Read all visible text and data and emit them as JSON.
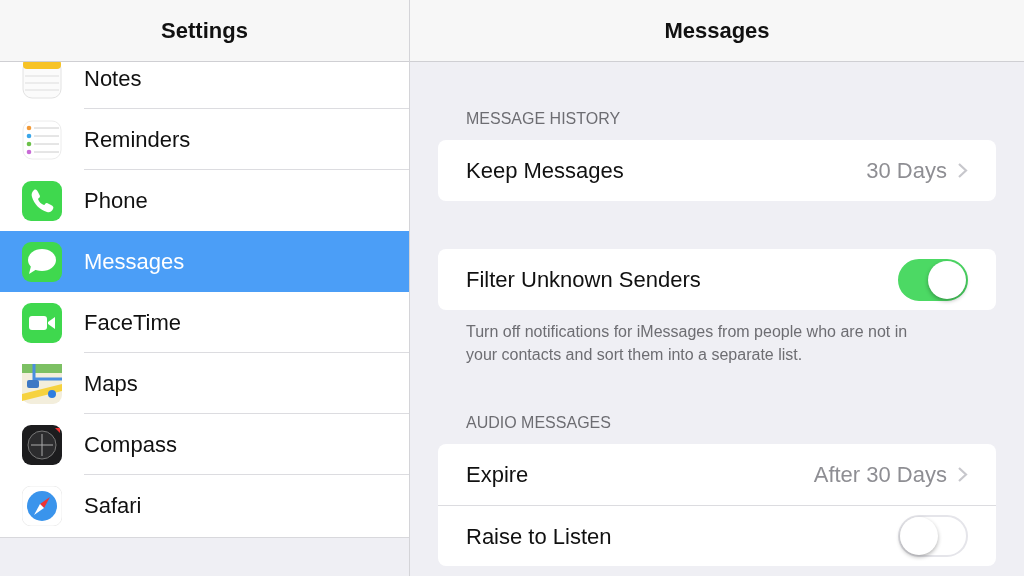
{
  "sidebar": {
    "title": "Settings",
    "items": [
      {
        "label": "Notes",
        "kind": "notes",
        "selected": false
      },
      {
        "label": "Reminders",
        "kind": "checklist",
        "selected": false
      },
      {
        "label": "Phone",
        "kind": "phone",
        "selected": false
      },
      {
        "label": "Messages",
        "kind": "chat",
        "selected": true
      },
      {
        "label": "FaceTime",
        "kind": "video",
        "selected": false
      },
      {
        "label": "Maps",
        "kind": "map",
        "selected": false
      },
      {
        "label": "Compass",
        "kind": "compass",
        "selected": false
      },
      {
        "label": "Safari",
        "kind": "browser",
        "selected": false
      }
    ]
  },
  "detail": {
    "title": "Messages",
    "sections": [
      {
        "header": "MESSAGE HISTORY",
        "rows": [
          {
            "kind": "value",
            "label": "Keep Messages",
            "value": "30 Days"
          }
        ]
      },
      {
        "rows": [
          {
            "kind": "toggle",
            "label": "Filter Unknown Senders",
            "on": true
          }
        ],
        "footer": "Turn off notifications for iMessages from people who are not in your contacts and sort them into a separate list."
      },
      {
        "header": "AUDIO MESSAGES",
        "rows": [
          {
            "kind": "value",
            "label": "Expire",
            "value": "After 30 Days"
          },
          {
            "kind": "toggle",
            "label": "Raise to Listen",
            "on": false
          }
        ]
      }
    ]
  }
}
